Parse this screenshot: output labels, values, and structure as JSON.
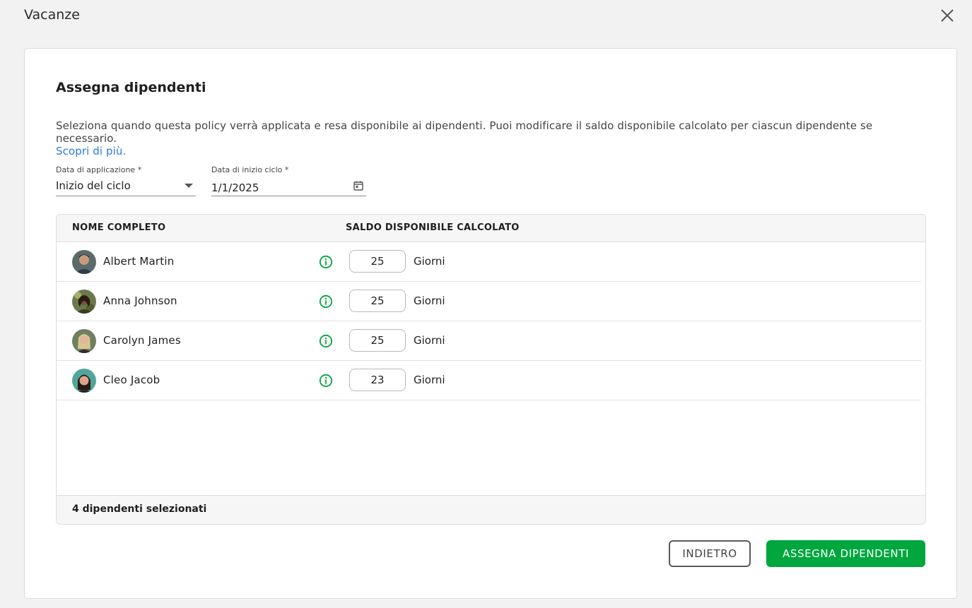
{
  "window": {
    "title": "Vacanze",
    "close_icon": "close-icon"
  },
  "card": {
    "title": "Assegna dipendenti",
    "description": "Seleziona quando questa policy verrà applicata e resa disponibile ai dipendenti. Puoi modificare il saldo disponibile calcolato per ciascun dipendente se necessario.",
    "learn_more": "Scopri di più."
  },
  "fields": {
    "application_date": {
      "label": "Data di applicazione *",
      "value": "Inizio del ciclo",
      "icon": "chevron-down-icon"
    },
    "cycle_start_date": {
      "label": "Data di inizio ciclo *",
      "value": "1/1/2025",
      "icon": "calendar-icon"
    }
  },
  "table": {
    "headers": {
      "name": "NOME COMPLETO",
      "balance": "SALDO DISPONIBILE CALCOLATO"
    },
    "rows": [
      {
        "name": "Albert Martin",
        "days": "25",
        "unit": "Giorni"
      },
      {
        "name": "Anna Johnson",
        "days": "25",
        "unit": "Giorni"
      },
      {
        "name": "Carolyn James",
        "days": "25",
        "unit": "Giorni"
      },
      {
        "name": "Cleo Jacob",
        "days": "23",
        "unit": "Giorni"
      }
    ],
    "footer": "4 dipendenti selezionati"
  },
  "buttons": {
    "back": "INDIETRO",
    "assign": "ASSEGNA DIPENDENTI"
  },
  "colors": {
    "accent_green": "#00a63e",
    "link_blue": "#2e7bd6",
    "info_icon_green": "#00a63e"
  }
}
